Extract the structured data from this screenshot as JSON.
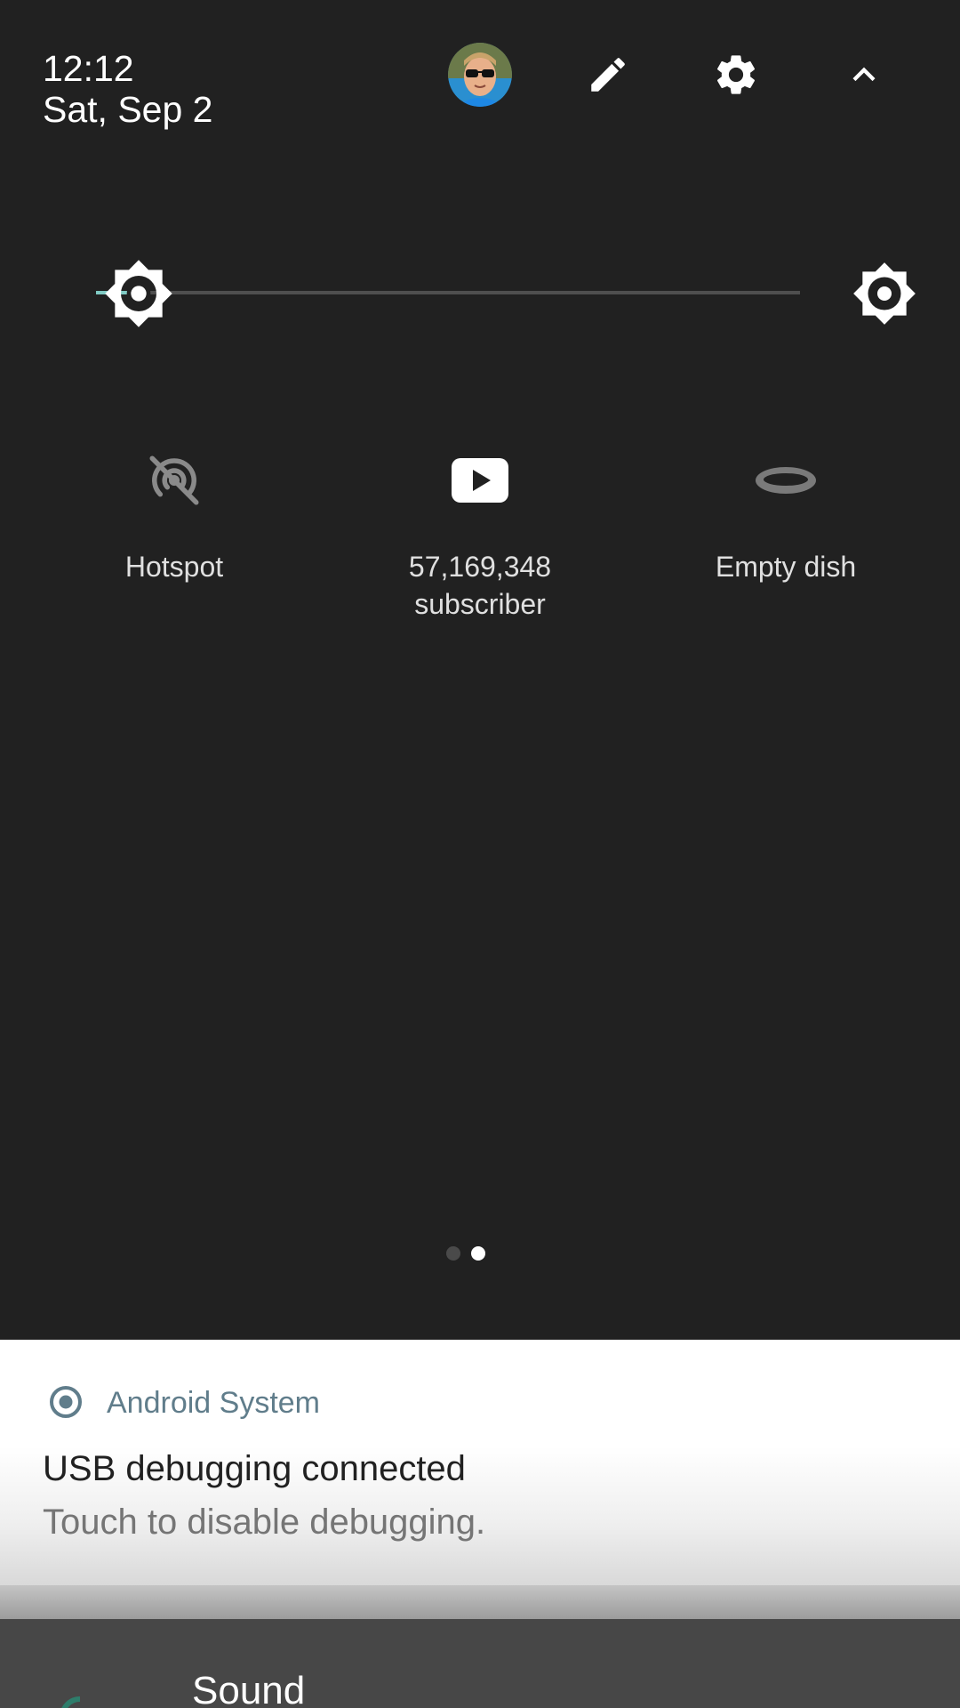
{
  "header": {
    "time": "12:12",
    "date": "Sat, Sep 2",
    "avatar_icon": "user-avatar",
    "edit_icon": "pencil-icon",
    "settings_icon": "gear-icon",
    "collapse_icon": "chevron-up-icon"
  },
  "brightness": {
    "level": 0.06,
    "accent_color": "#80cbc4",
    "icon": "brightness-icon",
    "auto_icon": "auto-brightness-icon"
  },
  "tiles": [
    {
      "label": "Hotspot",
      "icon": "hotspot-off-icon",
      "active": false
    },
    {
      "label": "57,169,348\nsubscriber",
      "icon": "youtube-play-icon",
      "active": true
    },
    {
      "label": "Empty dish",
      "icon": "dish-icon",
      "active": false
    }
  ],
  "pages": {
    "count": 2,
    "current": 2
  },
  "notification": {
    "app_name": "Android System",
    "app_icon": "radio-target-icon",
    "title": "USB debugging connected",
    "text": "Touch to disable debugging.",
    "app_name_color": "#607d8b"
  },
  "settings_peek": {
    "label": "Sound",
    "icon": "sound-icon"
  }
}
